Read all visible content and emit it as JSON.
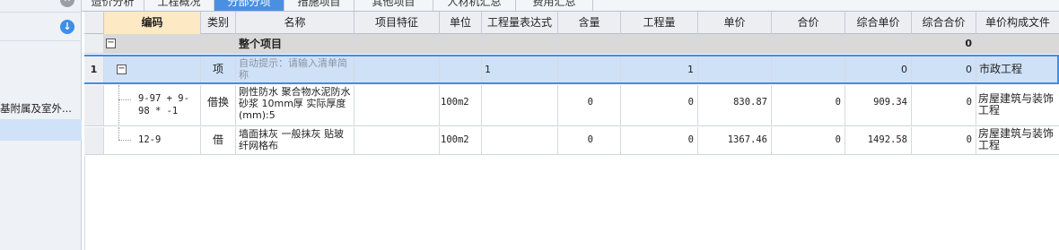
{
  "sidebar": {
    "item_label": "基附属及室外...",
    "icons": [
      "close-icon",
      "download-icon"
    ]
  },
  "tabs": [
    {
      "label": "造价分析",
      "active": false
    },
    {
      "label": "工程概况",
      "active": false
    },
    {
      "label": "分部分项",
      "active": true
    },
    {
      "label": "措施项目",
      "active": false
    },
    {
      "label": "其他项目",
      "active": false
    },
    {
      "label": "人材机汇总",
      "active": false
    },
    {
      "label": "费用汇总",
      "active": false
    }
  ],
  "columns": {
    "code": "编码",
    "type": "类别",
    "name": "名称",
    "feature": "项目特征",
    "unit": "单位",
    "expr": "工程量表达式",
    "content": "含量",
    "qty": "工程量",
    "price": "单价",
    "total": "合价",
    "comp_price": "综合单价",
    "comp_total": "综合合价",
    "file": "单价构成文件"
  },
  "rows": {
    "total": {
      "expander": "−",
      "name": "整个项目",
      "comp_total": "0"
    },
    "item": {
      "rownum": "1",
      "expander": "−",
      "type": "项",
      "name_placeholder": "自动提示：请输入清单简称",
      "expr": "1",
      "qty": "1",
      "comp_price": "0",
      "comp_total": "0",
      "file": "市政工程"
    },
    "sub1": {
      "code": "9-97 + 9-98 * -1",
      "type": "借换",
      "name": "刚性防水 聚合物水泥防水砂浆 10mm厚 实际厚度(mm):5",
      "unit": "100m2",
      "content": "0",
      "qty": "0",
      "price": "830.87",
      "total": "0",
      "comp_price": "909.34",
      "comp_total": "0",
      "file": "房屋建筑与装饰工程"
    },
    "sub2": {
      "code": "12-9",
      "type": "借",
      "name": "墙面抹灰 一般抹灰 贴玻纤网格布",
      "unit": "100m2",
      "content": "0",
      "qty": "0",
      "price": "1367.46",
      "total": "0",
      "comp_price": "1492.58",
      "comp_total": "0",
      "file": "房屋建筑与装饰工程"
    }
  }
}
